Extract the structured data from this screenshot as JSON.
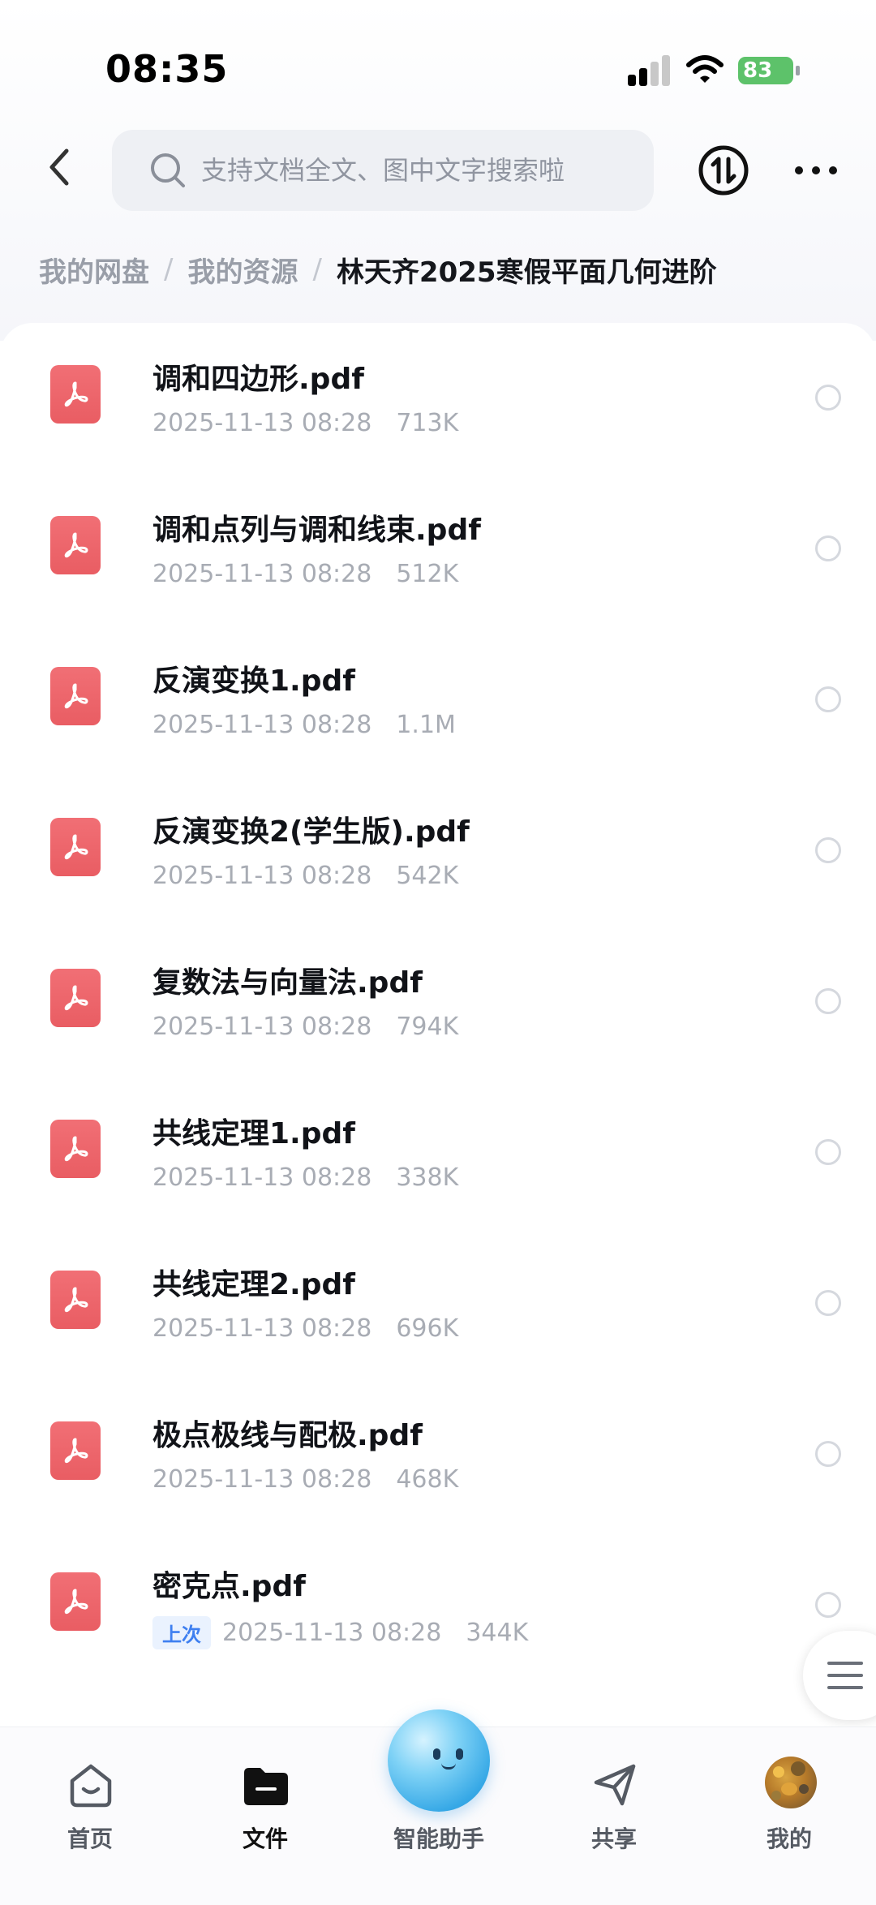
{
  "status_bar": {
    "time": "08:35",
    "battery": "83",
    "colors": {
      "battery": "#5dc26a"
    }
  },
  "header": {
    "back_icon": "chevron-left-icon",
    "search_placeholder": "支持文档全文、图中文字搜索啦",
    "sort_icon": "sort-toggle-icon",
    "more_icon": "more-horizontal-icon"
  },
  "breadcrumb": {
    "items": [
      "我的网盘",
      "我的资源"
    ],
    "current": "林天齐2025寒假平面几何进阶"
  },
  "files": [
    {
      "name": "调和四边形.pdf",
      "date": "2025-11-13 08:28",
      "size": "713K"
    },
    {
      "name": "调和点列与调和线束.pdf",
      "date": "2025-11-13 08:28",
      "size": "512K"
    },
    {
      "name": "反演变换1.pdf",
      "date": "2025-11-13 08:28",
      "size": "1.1M"
    },
    {
      "name": "反演变换2(学生版).pdf",
      "date": "2025-11-13 08:28",
      "size": "542K"
    },
    {
      "name": "复数法与向量法.pdf",
      "date": "2025-11-13 08:28",
      "size": "794K"
    },
    {
      "name": "共线定理1.pdf",
      "date": "2025-11-13 08:28",
      "size": "338K"
    },
    {
      "name": "共线定理2.pdf",
      "date": "2025-11-13 08:28",
      "size": "696K"
    },
    {
      "name": "极点极线与配极.pdf",
      "date": "2025-11-13 08:28",
      "size": "468K"
    },
    {
      "name": "密克点.pdf",
      "tag": "上次",
      "date": "2025-11-13 08:28",
      "size": "344K"
    }
  ],
  "tab_bar": {
    "tabs": [
      {
        "label": "首页",
        "icon": "home-icon"
      },
      {
        "label": "文件",
        "icon": "folder-icon",
        "active": true
      },
      {
        "label": "智能助手",
        "icon": "assistant-orb-icon"
      },
      {
        "label": "共享",
        "icon": "share-send-icon"
      },
      {
        "label": "我的",
        "icon": "profile-avatar"
      }
    ]
  },
  "float_menu_icon": "hamburger-menu-icon"
}
